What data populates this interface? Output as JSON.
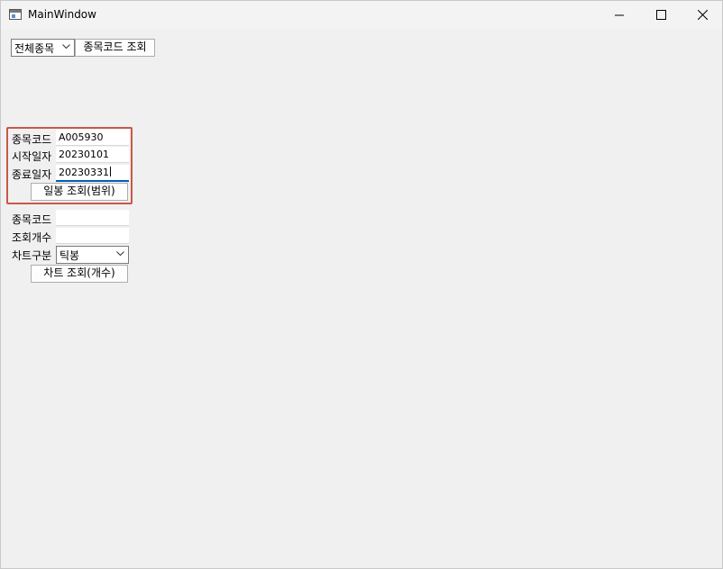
{
  "window": {
    "title": "MainWindow"
  },
  "toolbar": {
    "market_select": "전체종목",
    "lookup_button": "종목코드 조회"
  },
  "range_form": {
    "code_label": "종목코드",
    "code_value": "A005930",
    "start_label": "시작일자",
    "start_value": "20230101",
    "end_label": "종료일자",
    "end_value": "20230331",
    "submit_label": "일봉 조회(범위)"
  },
  "count_form": {
    "code_label": "종목코드",
    "code_value": "",
    "count_label": "조회개수",
    "count_value": "",
    "chart_type_label": "차트구분",
    "chart_type_value": "틱봉",
    "submit_label": "차트 조회(개수)"
  },
  "colors": {
    "highlight_border": "#c8584a",
    "focus_underline": "#005fb8"
  }
}
